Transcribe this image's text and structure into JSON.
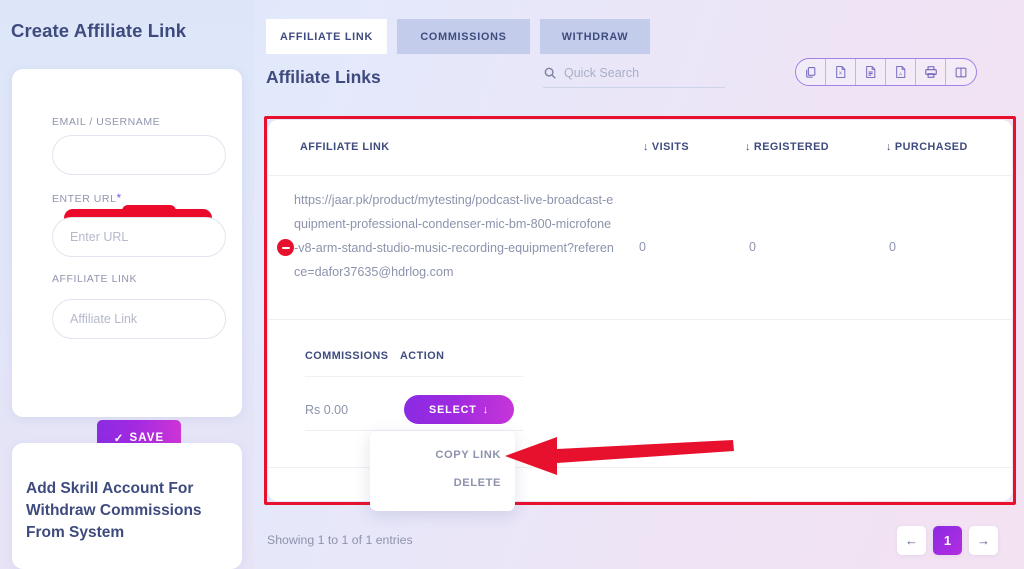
{
  "page": {
    "heading": "Create Affiliate Link",
    "section_title": "Affiliate Links"
  },
  "sidebar": {
    "create_card": {
      "email_label": "EMAIL / USERNAME",
      "email_value": "",
      "email_redacted": true,
      "url_label": "ENTER URL",
      "url_required_mark": "*",
      "url_placeholder": "Enter URL",
      "url_value": "",
      "affiliate_label": "AFFILIATE LINK",
      "affiliate_placeholder": "Affiliate Link",
      "affiliate_value": "",
      "save_label": "SAVE",
      "save_icon": "check-icon"
    },
    "skrill_card": {
      "title": "Add Skrill Account For Withdraw Commissions From System"
    }
  },
  "tabs": [
    {
      "label": "AFFILIATE LINK",
      "active": true
    },
    {
      "label": "COMMISSIONS",
      "active": false
    },
    {
      "label": "WITHDRAW",
      "active": false
    }
  ],
  "search": {
    "placeholder": "Quick Search",
    "value": "",
    "icon": "search-icon"
  },
  "export_toolbar": [
    {
      "name": "copy-icon",
      "title": "Copy"
    },
    {
      "name": "excel-icon",
      "title": "Excel"
    },
    {
      "name": "csv-icon",
      "title": "CSV"
    },
    {
      "name": "pdf-icon",
      "title": "PDF"
    },
    {
      "name": "print-icon",
      "title": "Print"
    },
    {
      "name": "columns-icon",
      "title": "Column visibility"
    }
  ],
  "table": {
    "columns": [
      {
        "label": "AFFILIATE LINK",
        "sort_icon": "↓",
        "sortable": false
      },
      {
        "label": "VISITS",
        "sort_icon": "↓",
        "sortable": true
      },
      {
        "label": "REGISTERED",
        "sort_icon": "↓",
        "sortable": true
      },
      {
        "label": "PURCHASED",
        "sort_icon": "↓",
        "sortable": true
      }
    ],
    "rows": [
      {
        "toggle_icon": "minus-circle-icon",
        "link": "https://jaar.pk/product/mytesting/podcast-live-broadcast-equipment-professional-condenser-mic-bm-800-microfone-v8-arm-stand-studio-music-recording-equipment?reference=dafor37635@hdrlog.com",
        "visits": "0",
        "registered": "0",
        "purchased": "0"
      }
    ],
    "sub_table": {
      "columns": [
        "COMMISSIONS",
        "ACTION"
      ],
      "commission_value": "Rs 0.00",
      "select_label": "SELECT",
      "select_icon": "↓"
    }
  },
  "dropdown": {
    "open": true,
    "items": [
      {
        "label": "COPY LINK"
      },
      {
        "label": "DELETE"
      }
    ]
  },
  "annotation": {
    "arrow_color": "#e8112d",
    "highlight_color": "#e8112d",
    "arrow_points_to": "COPY LINK"
  },
  "footer": {
    "showing_text": "Showing 1 to 1 of 1 entries",
    "prev_icon": "←",
    "next_icon": "→",
    "pages": [
      "1"
    ],
    "current_page": "1"
  },
  "colors": {
    "accent_purple": "#8a2be2",
    "accent_magenta": "#cf35d6",
    "heading_navy": "#3f4b7e",
    "muted_text": "#8d93ac",
    "annotation_red": "#e8112d"
  }
}
